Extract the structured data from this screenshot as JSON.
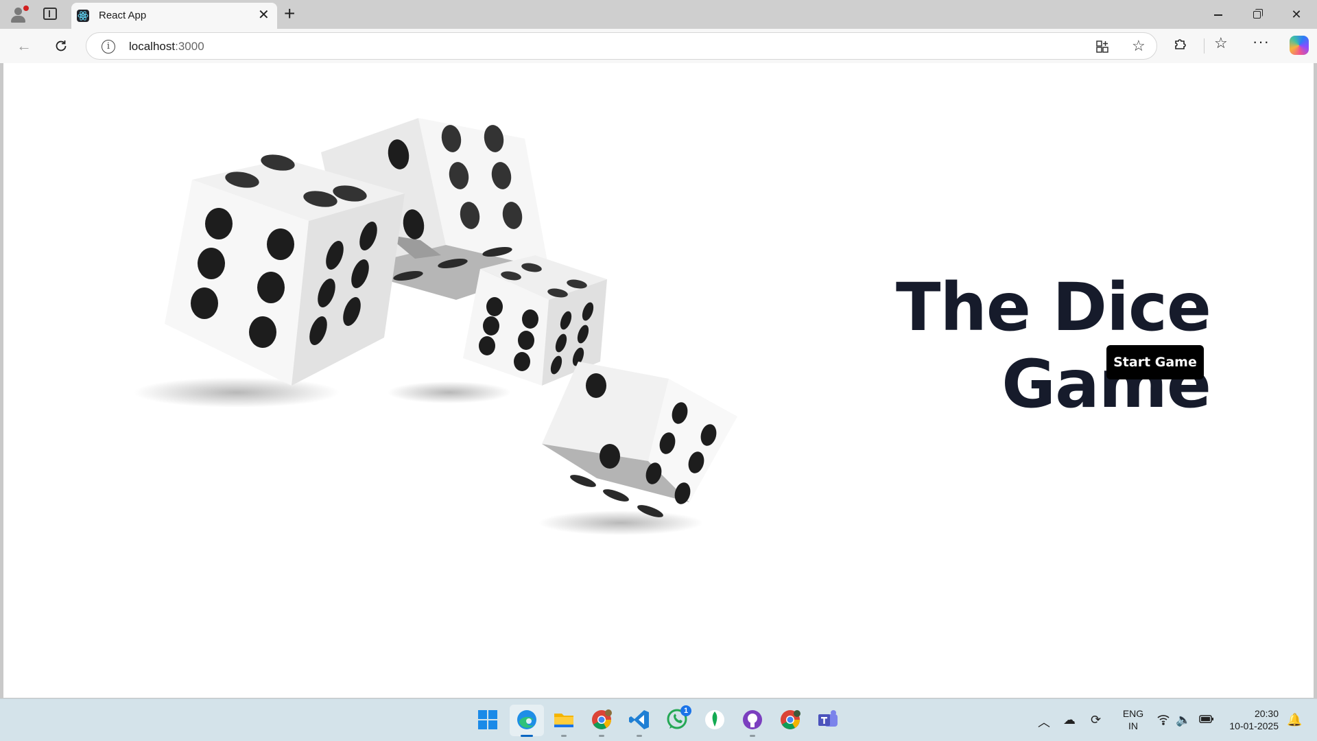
{
  "browser": {
    "tab_title": "React App",
    "url_host": "localhost",
    "url_port": ":3000"
  },
  "page": {
    "title": "The Dice Game",
    "start_button": "Start Game"
  },
  "taskbar": {
    "apps": [
      "windows-start",
      "edge",
      "file-explorer",
      "chrome",
      "vscode",
      "whatsapp",
      "mongodb-compass",
      "github-desktop",
      "chrome-profile",
      "teams"
    ],
    "whatsapp_badge": "1",
    "language_top": "ENG",
    "language_bottom": "IN",
    "time": "20:30",
    "date": "10-01-2025"
  },
  "colors": {
    "title": "#161b2b",
    "button_bg": "#000000",
    "taskbar": "#d4e3ea"
  }
}
